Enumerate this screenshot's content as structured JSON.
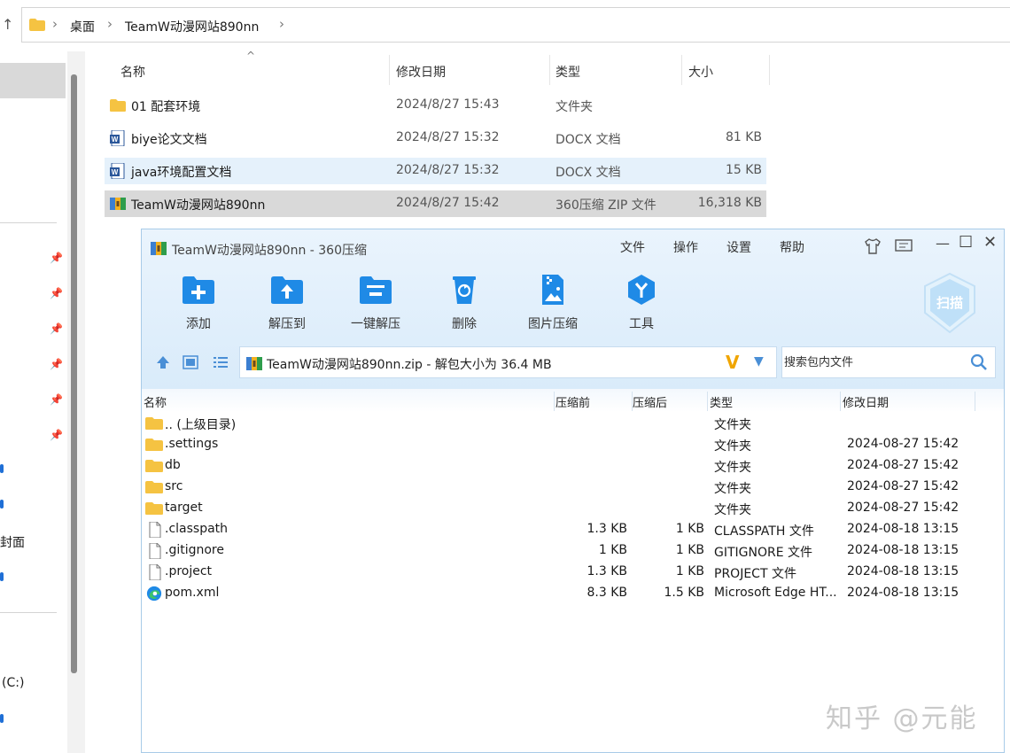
{
  "explorer": {
    "breadcrumb": [
      "桌面",
      "TeamW动漫网站890nn"
    ],
    "columns": [
      "名称",
      "修改日期",
      "类型",
      "大小"
    ],
    "files": [
      {
        "name": "01 配套环境",
        "date": "2024/8/27 15:43",
        "type": "文件夹",
        "size": "",
        "icon": "folder-icon"
      },
      {
        "name": "biye论文文档",
        "date": "2024/8/27 15:32",
        "type": "DOCX 文档",
        "size": "81 KB",
        "icon": "word-doc-icon"
      },
      {
        "name": "java环境配置文档",
        "date": "2024/8/27 15:32",
        "type": "DOCX 文档",
        "size": "15 KB",
        "icon": "word-doc-icon"
      },
      {
        "name": "TeamW动漫网站890nn",
        "date": "2024/8/27 15:42",
        "type": "360压缩 ZIP 文件",
        "size": "16,318 KB",
        "icon": "zip-archive-icon"
      }
    ],
    "left_pane_labels": [
      "封面",
      "(C:)"
    ]
  },
  "zip": {
    "title": "TeamW动漫网站890nn - 360压缩",
    "menu": [
      "文件",
      "操作",
      "设置",
      "帮助"
    ],
    "toolbar": [
      {
        "label": "添加",
        "icon": "add-icon"
      },
      {
        "label": "解压到",
        "icon": "extract-to-icon"
      },
      {
        "label": "一键解压",
        "icon": "one-click-extract-icon"
      },
      {
        "label": "删除",
        "icon": "delete-icon"
      },
      {
        "label": "图片压缩",
        "icon": "image-compress-icon"
      },
      {
        "label": "工具",
        "icon": "tools-icon"
      }
    ],
    "scan_label": "扫描",
    "path": "TeamW动漫网站890nn.zip - 解包大小为 36.4 MB",
    "search_placeholder": "搜索包内文件",
    "columns": [
      "名称",
      "压缩前",
      "压缩后",
      "类型",
      "修改日期"
    ],
    "files": [
      {
        "name": ".. (上级目录)",
        "before": "",
        "after": "",
        "type": "文件夹",
        "date": "",
        "icon": "folder-icon"
      },
      {
        "name": ".settings",
        "before": "",
        "after": "",
        "type": "文件夹",
        "date": "2024-08-27 15:42",
        "icon": "folder-icon"
      },
      {
        "name": "db",
        "before": "",
        "after": "",
        "type": "文件夹",
        "date": "2024-08-27 15:42",
        "icon": "folder-icon"
      },
      {
        "name": "src",
        "before": "",
        "after": "",
        "type": "文件夹",
        "date": "2024-08-27 15:42",
        "icon": "folder-icon"
      },
      {
        "name": "target",
        "before": "",
        "after": "",
        "type": "文件夹",
        "date": "2024-08-27 15:42",
        "icon": "folder-icon"
      },
      {
        "name": ".classpath",
        "before": "1.3 KB",
        "after": "1 KB",
        "type": "CLASSPATH 文件",
        "date": "2024-08-18 13:15",
        "icon": "file-icon"
      },
      {
        "name": ".gitignore",
        "before": "1 KB",
        "after": "1 KB",
        "type": "GITIGNORE 文件",
        "date": "2024-08-18 13:15",
        "icon": "file-icon"
      },
      {
        "name": ".project",
        "before": "1.3 KB",
        "after": "1 KB",
        "type": "PROJECT 文件",
        "date": "2024-08-18 13:15",
        "icon": "file-icon"
      },
      {
        "name": "pom.xml",
        "before": "8.3 KB",
        "after": "1.5 KB",
        "type": "Microsoft Edge HT...",
        "date": "2024-08-18 13:15",
        "icon": "edge-icon"
      }
    ]
  },
  "watermark": "知乎 @元能",
  "colors": {
    "accent": "#1f8ae6",
    "folder": "#f5c342",
    "selection": "#d9d9d9",
    "hover": "#e5f1fb"
  }
}
